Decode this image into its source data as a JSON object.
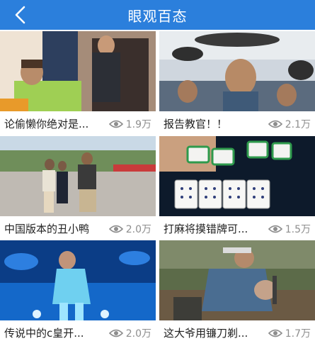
{
  "header": {
    "title": "眼观百态",
    "back_icon": "chevron-left-icon"
  },
  "colors": {
    "header_bg": "#2b7fdc",
    "caption_text": "#222222",
    "views_text": "#8e8e8e"
  },
  "videos": [
    {
      "title": "论偷懒你绝对是...",
      "views": "1.9万"
    },
    {
      "title": "报告教官！！",
      "views": "2.1万"
    },
    {
      "title": "中国版本的丑小鸭",
      "views": "2.0万"
    },
    {
      "title": "打麻将摸错牌可...",
      "views": "1.5万"
    },
    {
      "title": "传说中的c皇开...",
      "views": "2.0万"
    },
    {
      "title": "这大爷用镰刀剃...",
      "views": "1.7万"
    }
  ]
}
